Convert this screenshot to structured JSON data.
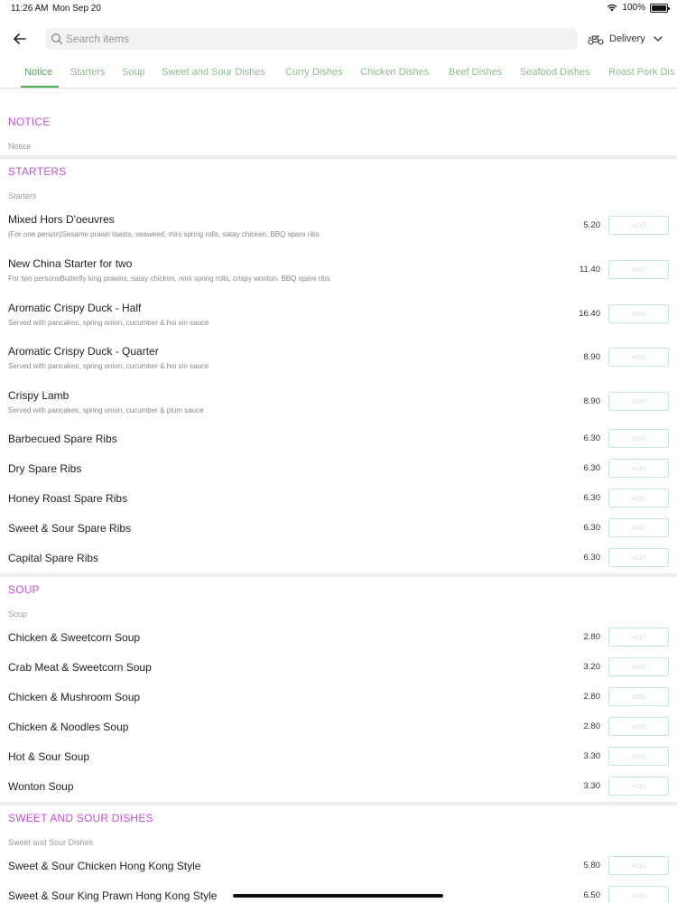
{
  "status": {
    "time": "11:26 AM",
    "date": "Mon Sep 20",
    "battery": "100%"
  },
  "header": {
    "search_placeholder": "Search items",
    "mode_label": "Delivery"
  },
  "tabs": [
    {
      "label": "Notice",
      "active": true
    },
    {
      "label": "Starters"
    },
    {
      "label": "Soup"
    },
    {
      "label": "Sweet and Sour Dishes"
    },
    {
      "label": "Curry Dishes"
    },
    {
      "label": "Chicken Dishes"
    },
    {
      "label": "Beef Dishes"
    },
    {
      "label": "Seafood Dishes"
    },
    {
      "label": "Roast Pork Dis"
    }
  ],
  "add_label": "ADD",
  "sections": [
    {
      "title": "NOTICE",
      "subtitle": "Notice",
      "items": []
    },
    {
      "title": "STARTERS",
      "subtitle": "Starters",
      "items": [
        {
          "name": "Mixed Hors D'oeuvres",
          "desc": "(For one person)Sesame prawn toasts, seaweed, mini spring rolls, satay chicken, BBQ spare ribs",
          "price": "5.20"
        },
        {
          "name": "New China Starter for two",
          "desc": "For two personsButterfly king prawns, satay chicken, mini spring rolls, crispy wonton, BBQ spare ribs",
          "price": "11.40"
        },
        {
          "name": "Aromatic Crispy Duck - Half",
          "desc": "Served with pancakes, spring onion, cucumber &  hoi sin sauce",
          "price": "16.40"
        },
        {
          "name": "Aromatic Crispy Duck - Quarter",
          "desc": "Served with pancakes, spring onion, cucumber & hoi sin sauce",
          "price": "8.90"
        },
        {
          "name": "Crispy Lamb",
          "desc": "Served with pancakes, spring onion, cucumber & plum sauce",
          "price": "8.90"
        },
        {
          "name": "Barbecued Spare Ribs",
          "price": "6.30"
        },
        {
          "name": "Dry Spare Ribs",
          "price": "6.30"
        },
        {
          "name": "Honey Roast Spare Ribs",
          "price": "6.30"
        },
        {
          "name": "Sweet & Sour Spare Ribs",
          "price": "6.30"
        },
        {
          "name": "Capital Spare Ribs",
          "price": "6.30"
        }
      ]
    },
    {
      "title": "SOUP",
      "subtitle": "Soup",
      "items": [
        {
          "name": "Chicken & Sweetcorn Soup",
          "price": "2.80"
        },
        {
          "name": "Crab Meat & Sweetcorn Soup",
          "price": "3.20"
        },
        {
          "name": "Chicken & Mushroom Soup",
          "price": "2.80"
        },
        {
          "name": "Chicken & Noodles Soup",
          "price": "2.80"
        },
        {
          "name": "Hot & Sour Soup",
          "price": "3.30"
        },
        {
          "name": "Wonton Soup",
          "price": "3.30"
        }
      ]
    },
    {
      "title": "SWEET AND SOUR DISHES",
      "subtitle": "Sweet and Sour Dishes",
      "items": [
        {
          "name": "Sweet & Sour Chicken Hong Kong Style",
          "price": "5.80"
        },
        {
          "name": "Sweet & Sour King Prawn Hong Kong Style",
          "price": "6.50"
        }
      ]
    }
  ]
}
